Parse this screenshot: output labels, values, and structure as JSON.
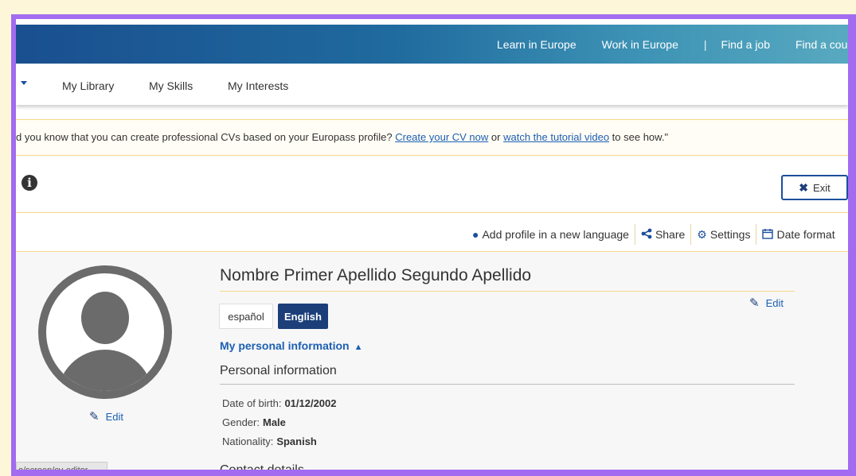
{
  "topbar": {
    "links": [
      "Learn in Europe",
      "Work in Europe",
      "|",
      "Find a job",
      "Find a course"
    ]
  },
  "subnav": {
    "items": [
      "My Library",
      "My Skills",
      "My Interests"
    ]
  },
  "notice": {
    "text_before": "d you know that you can create professional CVs based on your Europass profile? ",
    "link1": "Create your CV now",
    "text_middle": " or ",
    "link2": "watch the tutorial video",
    "text_after": " to see how.\""
  },
  "header": {
    "exit_label": "Exit"
  },
  "toolbar": {
    "add_language": "Add profile in a new language",
    "share": "Share",
    "settings": "Settings",
    "date_format": "Date format"
  },
  "profile": {
    "name": "Nombre Primer Apellido Segundo Apellido",
    "edit_label": "Edit",
    "photo_edit_label": "Edit",
    "languages": [
      "español",
      "English"
    ],
    "personal_info_toggle": "My personal information",
    "section_title": "Personal information",
    "fields": [
      {
        "label": "Date of birth:",
        "value": "01/12/2002"
      },
      {
        "label": "Gender:",
        "value": "Male"
      },
      {
        "label": "Nationality:",
        "value": "Spanish"
      }
    ],
    "next_section": "Contact details"
  },
  "status": {
    "url_preview": "o/screen/cv-editor"
  },
  "colors": {
    "accent": "#1c3f7a",
    "link": "#1c5fb3",
    "frame": "#a26bf0",
    "highlight_rule": "#f3d98a"
  }
}
